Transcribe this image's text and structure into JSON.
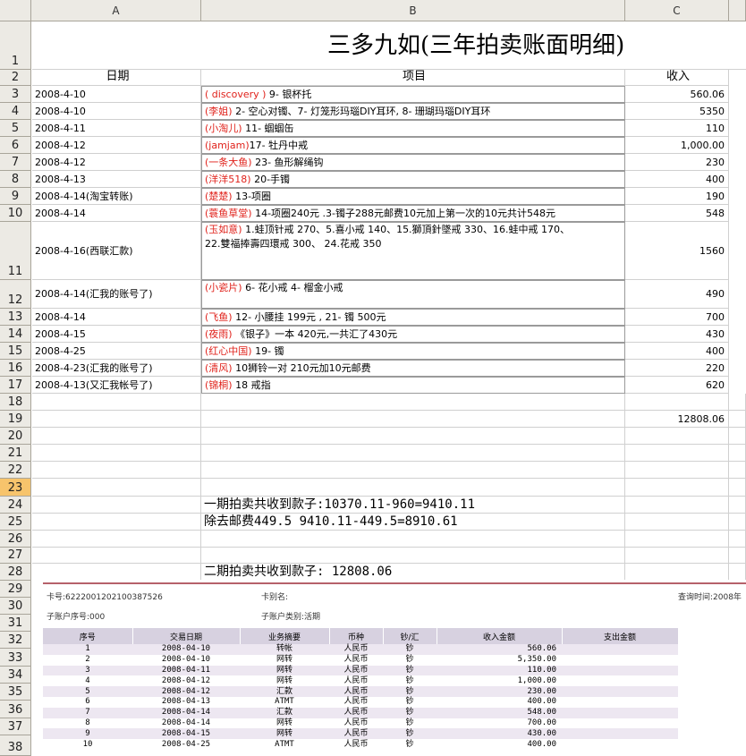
{
  "columns": [
    "A",
    "B",
    "C"
  ],
  "row_numbers": [
    "1",
    "2",
    "3",
    "4",
    "5",
    "6",
    "7",
    "8",
    "9",
    "10",
    "11",
    "12",
    "13",
    "14",
    "15",
    "16",
    "17",
    "18",
    "19",
    "20",
    "21",
    "22",
    "23",
    "24",
    "25",
    "26",
    "27",
    "28",
    "29",
    "30",
    "31",
    "32",
    "33",
    "34",
    "35",
    "36",
    "37",
    "38"
  ],
  "selected_row": "23",
  "title": "三多九如(三年拍卖账面明细)",
  "headers": {
    "date": "日期",
    "item": "项目",
    "income": "收入"
  },
  "rows": [
    {
      "date": "2008-4-10",
      "buyer": "( discovery )",
      "item": " 9- 银杯托",
      "income": "560.06"
    },
    {
      "date": "2008-4-10",
      "buyer": "(李姐)",
      "item": " 2- 空心对镯、7- 灯笼形玛瑙DIY耳环, 8- 珊瑚玛瑙DIY耳环",
      "income": "5350"
    },
    {
      "date": "2008-4-11",
      "buyer": "(小淘儿)",
      "item": " 11- 蝈蝈缶",
      "income": "110"
    },
    {
      "date": "2008-4-12",
      "buyer": "(jamjam)",
      "item": "17- 牡丹中戒",
      "income": "1,000.00"
    },
    {
      "date": "2008-4-12",
      "buyer": "(一条大鱼)",
      "item": " 23- 鱼形解绳钩",
      "income": "230"
    },
    {
      "date": "2008-4-13",
      "buyer": "(洋洋518)",
      "item": " 20-手镯",
      "income": "400"
    },
    {
      "date": "2008-4-14(淘宝转账)",
      "buyer": "(楚楚)",
      "item": " 13-项圈",
      "income": "190"
    },
    {
      "date": "2008-4-14",
      "buyer": "(蓑鱼草堂)",
      "item": " 14-项圈240元 .3-镯子288元邮费10元加上第一次的10元共计548元",
      "income": "548"
    },
    {
      "date": "2008-4-16(西联汇款)",
      "buyer": "(玉如意)",
      "item": " 1.蛙顶针戒 270、5.喜小戒 140、15.獅頂針墜戒 330、16.蛙中戒 170、",
      "item2": "22.雙福捧壽四環戒 300、 24.花戒 350",
      "income": "1560"
    },
    {
      "date": "2008-4-14(汇我的账号了)",
      "buyer": "(小瓷片)",
      "item": " 6- 花小戒 4- 榴金小戒",
      "income": "490"
    },
    {
      "date": "2008-4-14",
      "buyer": "(飞鱼)",
      "item": " 12- 小腰挂 199元 , 21- 镯 500元",
      "income": "700"
    },
    {
      "date": "2008-4-15",
      "buyer": "(夜雨)",
      "item": " 《银子》一本 420元,一共汇了430元",
      "income": "430"
    },
    {
      "date": "2008-4-25",
      "buyer": "(红心中国)",
      "item": " 19- 镯",
      "income": "400"
    },
    {
      "date": "2008-4-23(汇我的账号了)",
      "buyer": "(清风)",
      "item": " 10狮铃一对  210元加10元邮费",
      "income": "220"
    },
    {
      "date": "2008-4-13(又汇我帐号了)",
      "buyer": "(锦桐)",
      "item": " 18 戒指",
      "income": "620"
    }
  ],
  "total": "12808.06",
  "notes": {
    "line1": "一期拍卖共收到款子:10370.11-960=9410.11",
    "line2": "除去邮费449.5  9410.11-449.5=8910.61",
    "line3": "二期拍卖共收到款子: 12808.06"
  },
  "statement": {
    "card_no": "卡号:6222001202100387526",
    "card_alias": "卡别名:",
    "query_time": "查询时间:2008年",
    "sub_no": "子账户序号:000",
    "sub_type": "子账户类别:活期",
    "headers": [
      "序号",
      "交易日期",
      "业务摘要",
      "币种",
      "钞/汇",
      "收入金额",
      "支出金额"
    ],
    "rows": [
      [
        "1",
        "2008-04-10",
        "转帐",
        "人民币",
        "钞",
        "560.06",
        ""
      ],
      [
        "2",
        "2008-04-10",
        "网转",
        "人民币",
        "钞",
        "5,350.00",
        ""
      ],
      [
        "3",
        "2008-04-11",
        "网转",
        "人民币",
        "钞",
        "110.00",
        ""
      ],
      [
        "4",
        "2008-04-12",
        "网转",
        "人民币",
        "钞",
        "1,000.00",
        ""
      ],
      [
        "5",
        "2008-04-12",
        "汇款",
        "人民币",
        "钞",
        "230.00",
        ""
      ],
      [
        "6",
        "2008-04-13",
        "ATMT",
        "人民币",
        "钞",
        "400.00",
        ""
      ],
      [
        "7",
        "2008-04-14",
        "汇款",
        "人民币",
        "钞",
        "548.00",
        ""
      ],
      [
        "8",
        "2008-04-14",
        "网转",
        "人民币",
        "钞",
        "700.00",
        ""
      ],
      [
        "9",
        "2008-04-15",
        "网转",
        "人民币",
        "钞",
        "430.00",
        ""
      ],
      [
        "10",
        "2008-04-25",
        "ATMT",
        "人民币",
        "钞",
        "400.00",
        ""
      ]
    ]
  }
}
